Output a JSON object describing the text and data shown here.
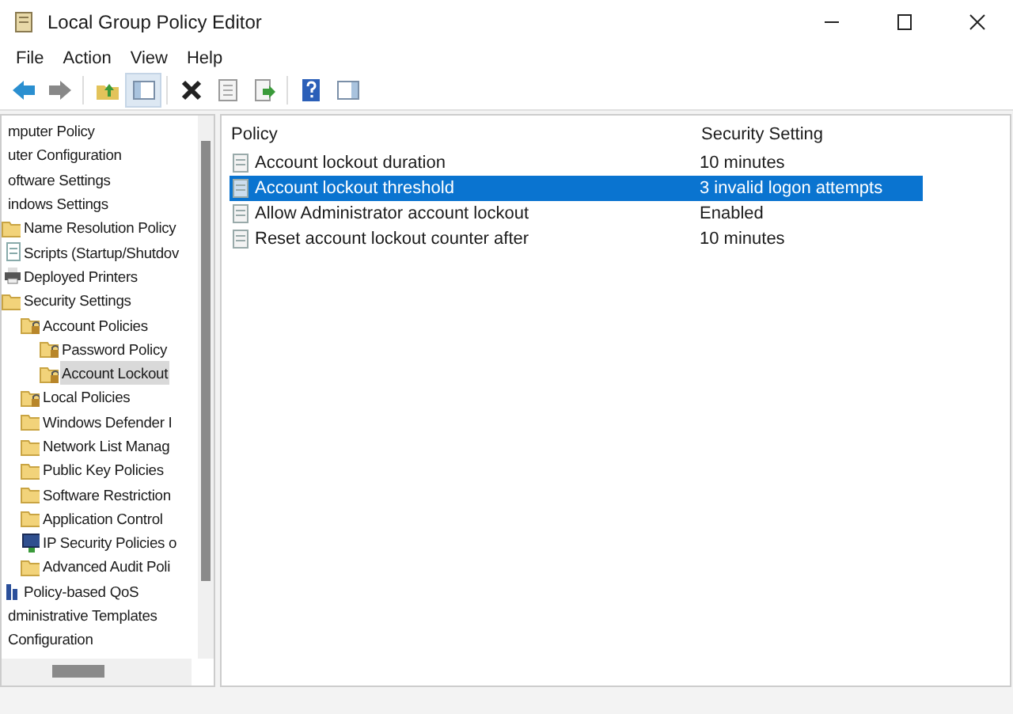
{
  "window": {
    "title": "Local Group Policy Editor"
  },
  "menu": [
    {
      "label": "File"
    },
    {
      "label": "Action"
    },
    {
      "label": "View"
    },
    {
      "label": "Help"
    }
  ],
  "toolbar": [
    {
      "kind": "back",
      "pressed": false
    },
    {
      "kind": "forward",
      "pressed": false
    },
    {
      "kind": "up",
      "pressed": false
    },
    {
      "kind": "tree",
      "pressed": true
    },
    {
      "kind": "delete",
      "pressed": false
    },
    {
      "kind": "properties",
      "pressed": false
    },
    {
      "kind": "export",
      "pressed": false
    },
    {
      "kind": "help",
      "pressed": false
    },
    {
      "kind": "pane",
      "pressed": false
    }
  ],
  "tree": [
    {
      "label": "mputer Policy",
      "selected": false,
      "children": [
        {
          "label": "uter Configuration",
          "selected": false,
          "children": [
            {
              "label": "oftware Settings",
              "selected": false
            },
            {
              "label": "indows Settings",
              "selected": false,
              "children": [
                {
                  "label": "Name Resolution Policy",
                  "kind": "folder",
                  "selected": false
                },
                {
                  "label": "Scripts (Startup/Shutdov",
                  "kind": "script",
                  "selected": false
                },
                {
                  "label": "Deployed Printers",
                  "kind": "printer",
                  "selected": false
                },
                {
                  "label": "Security Settings",
                  "kind": "folder",
                  "selected": false,
                  "children": [
                    {
                      "label": "Account Policies",
                      "kind": "lockfolder",
                      "selected": false,
                      "children": [
                        {
                          "label": "Password Policy",
                          "kind": "lockfolder",
                          "selected": false
                        },
                        {
                          "label": "Account Lockout",
                          "kind": "lockfolder",
                          "selected": true
                        }
                      ]
                    },
                    {
                      "label": "Local Policies",
                      "kind": "lockfolder",
                      "selected": false
                    },
                    {
                      "label": "Windows Defender I",
                      "kind": "folder",
                      "selected": false
                    },
                    {
                      "label": "Network List Manag",
                      "kind": "folder",
                      "selected": false
                    },
                    {
                      "label": "Public Key Policies",
                      "kind": "folder",
                      "selected": false
                    },
                    {
                      "label": "Software Restriction",
                      "kind": "folder",
                      "selected": false
                    },
                    {
                      "label": "Application Control",
                      "kind": "folder",
                      "selected": false
                    },
                    {
                      "label": "IP Security Policies o",
                      "kind": "monitor",
                      "selected": false
                    },
                    {
                      "label": "Advanced Audit Poli",
                      "kind": "folder",
                      "selected": false
                    }
                  ]
                },
                {
                  "label": "Policy-based QoS",
                  "kind": "chart",
                  "selected": false
                }
              ]
            },
            {
              "label": "dministrative Templates",
              "selected": false
            }
          ]
        },
        {
          "label": "Configuration",
          "selected": false
        }
      ]
    }
  ],
  "list": {
    "columns": [
      "Policy",
      "Security Setting"
    ],
    "rows": [
      {
        "policy": "Account lockout duration",
        "setting": "10 minutes",
        "selected": false
      },
      {
        "policy": "Account lockout threshold",
        "setting": "3 invalid logon attempts",
        "selected": true
      },
      {
        "policy": "Allow Administrator account lockout",
        "setting": "Enabled",
        "selected": false
      },
      {
        "policy": "Reset account lockout counter after",
        "setting": "10 minutes",
        "selected": false
      }
    ]
  }
}
